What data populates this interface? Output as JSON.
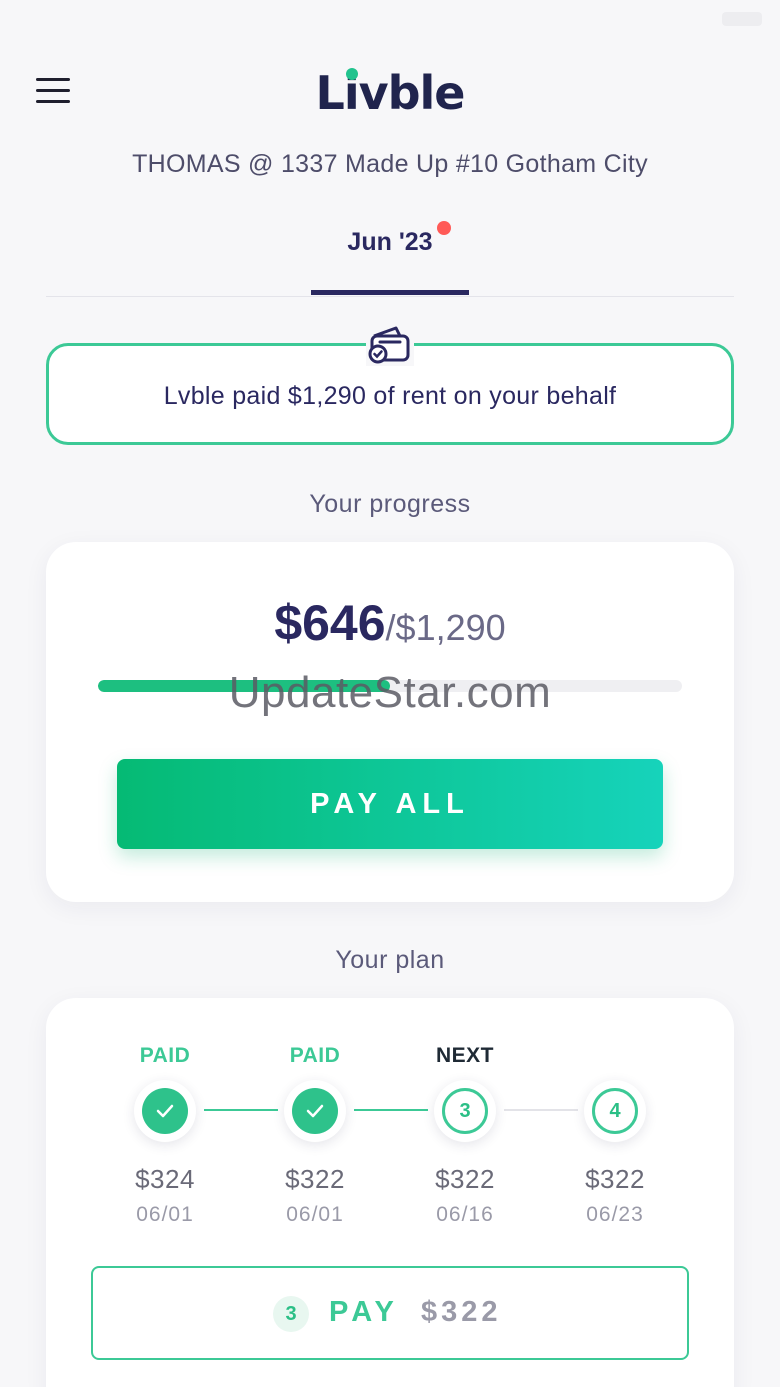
{
  "header": {
    "logo_text": "Livble",
    "address": "THOMAS @ 1337 Made Up #10 Gotham City",
    "tab_label": "Jun '23"
  },
  "notice": {
    "text": "Lvble paid $1,290 of rent on your behalf"
  },
  "progress": {
    "section_title": "Your progress",
    "paid_amount": "$646",
    "total_amount": "/$1,290",
    "fraction": 0.5,
    "watermark": "UpdateStar.com",
    "pay_all_label": "PAY ALL"
  },
  "plan": {
    "section_title": "Your plan",
    "steps": [
      {
        "status": "PAID",
        "marker": "",
        "amount": "$324",
        "date": "06/01"
      },
      {
        "status": "PAID",
        "marker": "",
        "amount": "$322",
        "date": "06/01"
      },
      {
        "status": "NEXT",
        "marker": "3",
        "amount": "$322",
        "date": "06/16"
      },
      {
        "status": "",
        "marker": "4",
        "amount": "$322",
        "date": "06/23"
      }
    ],
    "pay_next": {
      "badge": "3",
      "label": "PAY",
      "amount": "$322"
    }
  },
  "colors": {
    "accent_green": "#3cc996",
    "navy": "#2a2860",
    "alert_red": "#ff5a57"
  }
}
